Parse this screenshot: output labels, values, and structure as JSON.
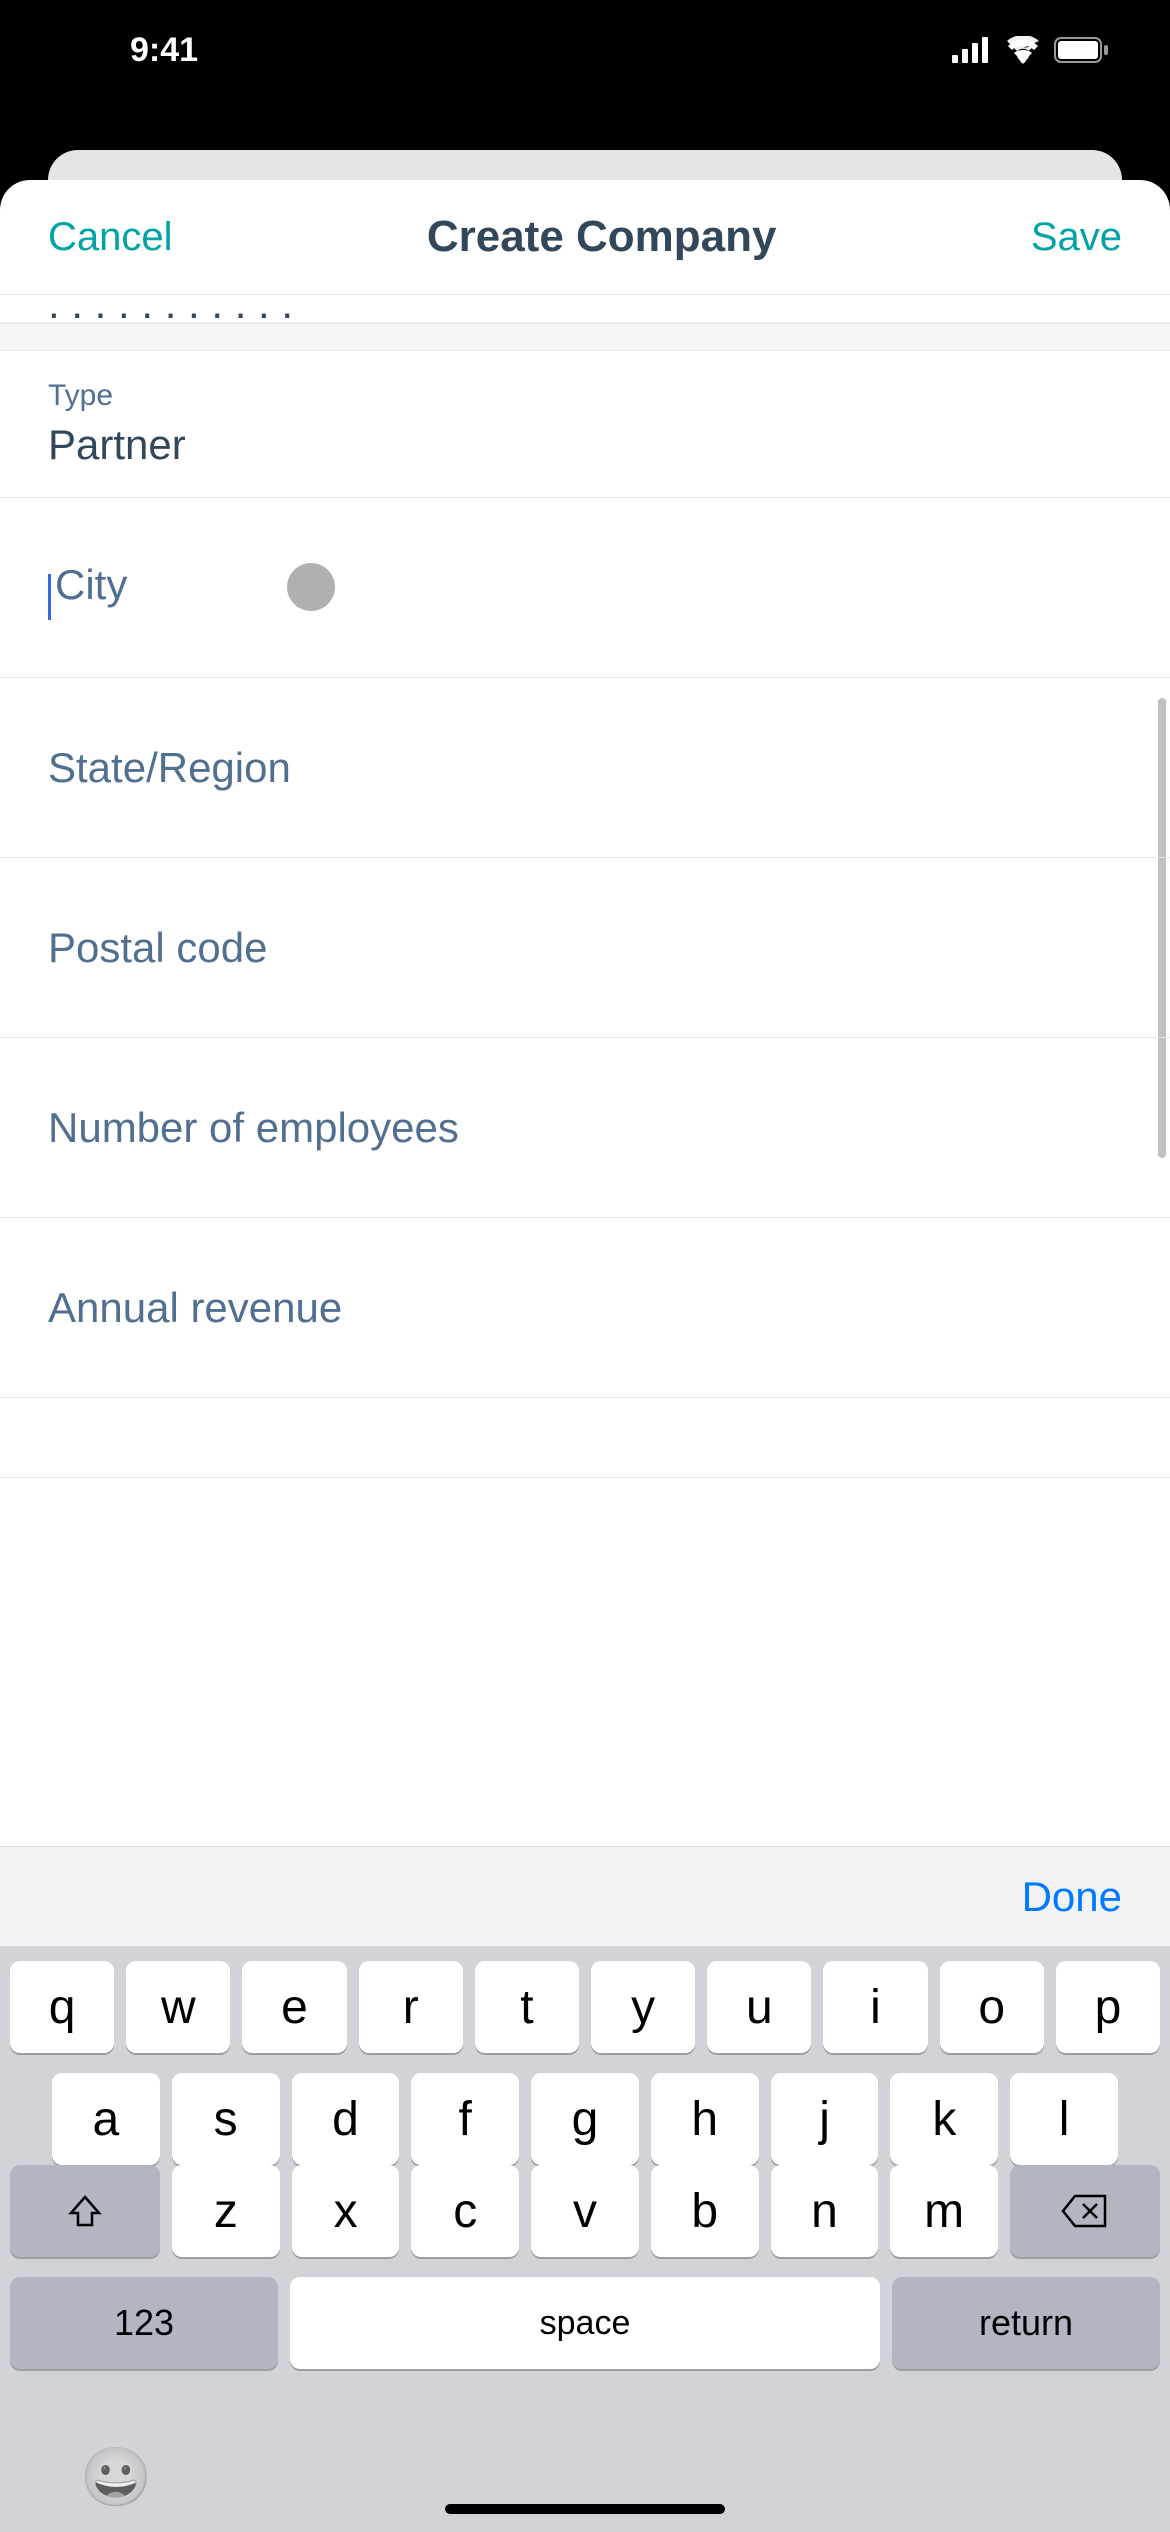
{
  "status": {
    "time": "9:41"
  },
  "header": {
    "cancel": "Cancel",
    "title": "Create Company",
    "save": "Save"
  },
  "form": {
    "type_label": "Type",
    "type_value": "Partner",
    "city_placeholder": "City",
    "state_placeholder": "State/Region",
    "postal_placeholder": "Postal code",
    "employees_placeholder": "Number of employees",
    "revenue_placeholder": "Annual revenue"
  },
  "keyboard": {
    "done": "Done",
    "row1": [
      "q",
      "w",
      "e",
      "r",
      "t",
      "y",
      "u",
      "i",
      "o",
      "p"
    ],
    "row2": [
      "a",
      "s",
      "d",
      "f",
      "g",
      "h",
      "j",
      "k",
      "l"
    ],
    "row3": [
      "z",
      "x",
      "c",
      "v",
      "b",
      "n",
      "m"
    ],
    "num": "123",
    "space": "space",
    "return": "return"
  }
}
